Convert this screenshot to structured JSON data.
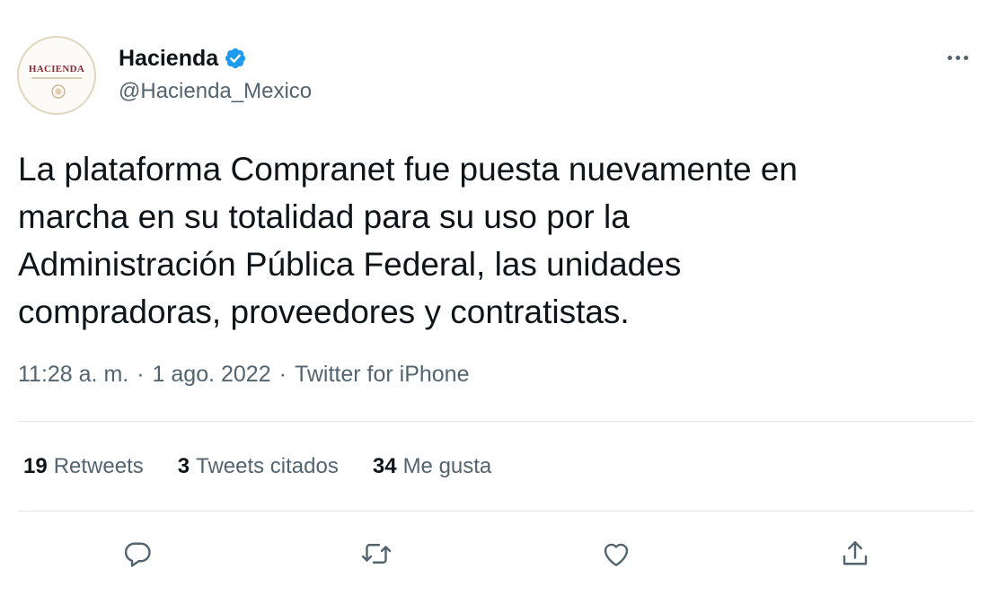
{
  "account": {
    "avatar_text": "HACIENDA",
    "display_name": "Hacienda",
    "verified": true,
    "handle": "@Hacienda_Mexico"
  },
  "tweet": {
    "text": "La plataforma Compranet fue puesta nuevamente en\nmarcha en su totalidad para su uso por la\nAdministración Pública Federal, las unidades\ncompradoras, proveedores y contratistas.",
    "time": "11:28 a. m.",
    "separator": "·",
    "date": "1 ago. 2022",
    "source": "Twitter for iPhone"
  },
  "stats": [
    {
      "count": "19",
      "label": "Retweets"
    },
    {
      "count": "3",
      "label": "Tweets citados"
    },
    {
      "count": "34",
      "label": "Me gusta"
    }
  ],
  "actions": [
    {
      "icon": "reply-icon"
    },
    {
      "icon": "retweet-icon"
    },
    {
      "icon": "like-icon"
    },
    {
      "icon": "share-icon"
    }
  ],
  "colors": {
    "verified_badge": "#1d9bf0",
    "secondary_text": "#536471",
    "primary_text": "#0f1419",
    "divider": "#e1e7eb"
  }
}
